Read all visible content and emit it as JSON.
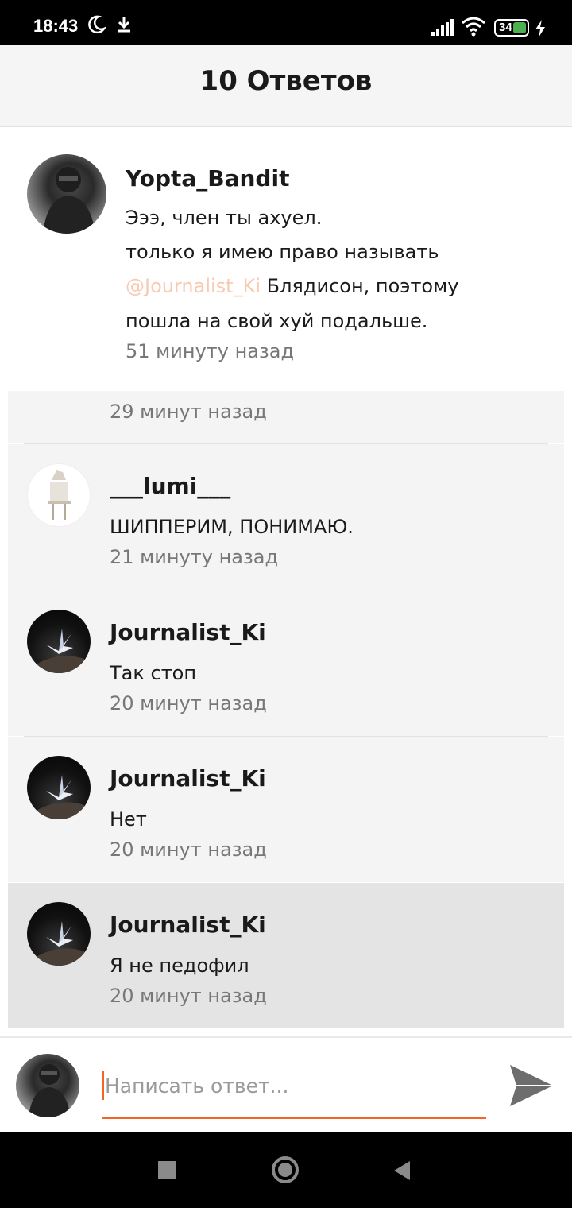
{
  "status_bar": {
    "time": "18:43",
    "battery": "34",
    "icons": [
      "moon-icon",
      "download-icon",
      "signal-icon",
      "wifi-icon",
      "battery-icon",
      "charging-icon"
    ]
  },
  "header": {
    "title": "10 Ответов"
  },
  "parent_comment": {
    "username": "Yopta_Bandit",
    "line1": "Эээ, член ты ахуел.",
    "line2": "только я имею право называть",
    "mention": "@Journalist_Ki",
    "line3_rest": " Блядисон, поэтому",
    "line4": "пошла на свой хуй подальше.",
    "time": "51 минуту назад"
  },
  "partial_reply": {
    "time": "29 минут назад"
  },
  "replies": [
    {
      "username": "___lumi___",
      "text": "ШИППЕРИМ, ПОНИМАЮ.",
      "time": "21 минуту назад"
    },
    {
      "username": "Journalist_Ki",
      "text": "Так стоп",
      "time": "20 минут назад"
    },
    {
      "username": "Journalist_Ki",
      "text": "Нет",
      "time": "20 минут назад"
    },
    {
      "username": "Journalist_Ki",
      "text": "Я не педофил",
      "time": "20 минут назад"
    }
  ],
  "composer": {
    "placeholder": "Написать ответ..."
  },
  "colors": {
    "accent": "#f26522",
    "mention": "#f6cbb2",
    "panel": "#f4f4f4",
    "panel_active": "#e4e4e4"
  }
}
